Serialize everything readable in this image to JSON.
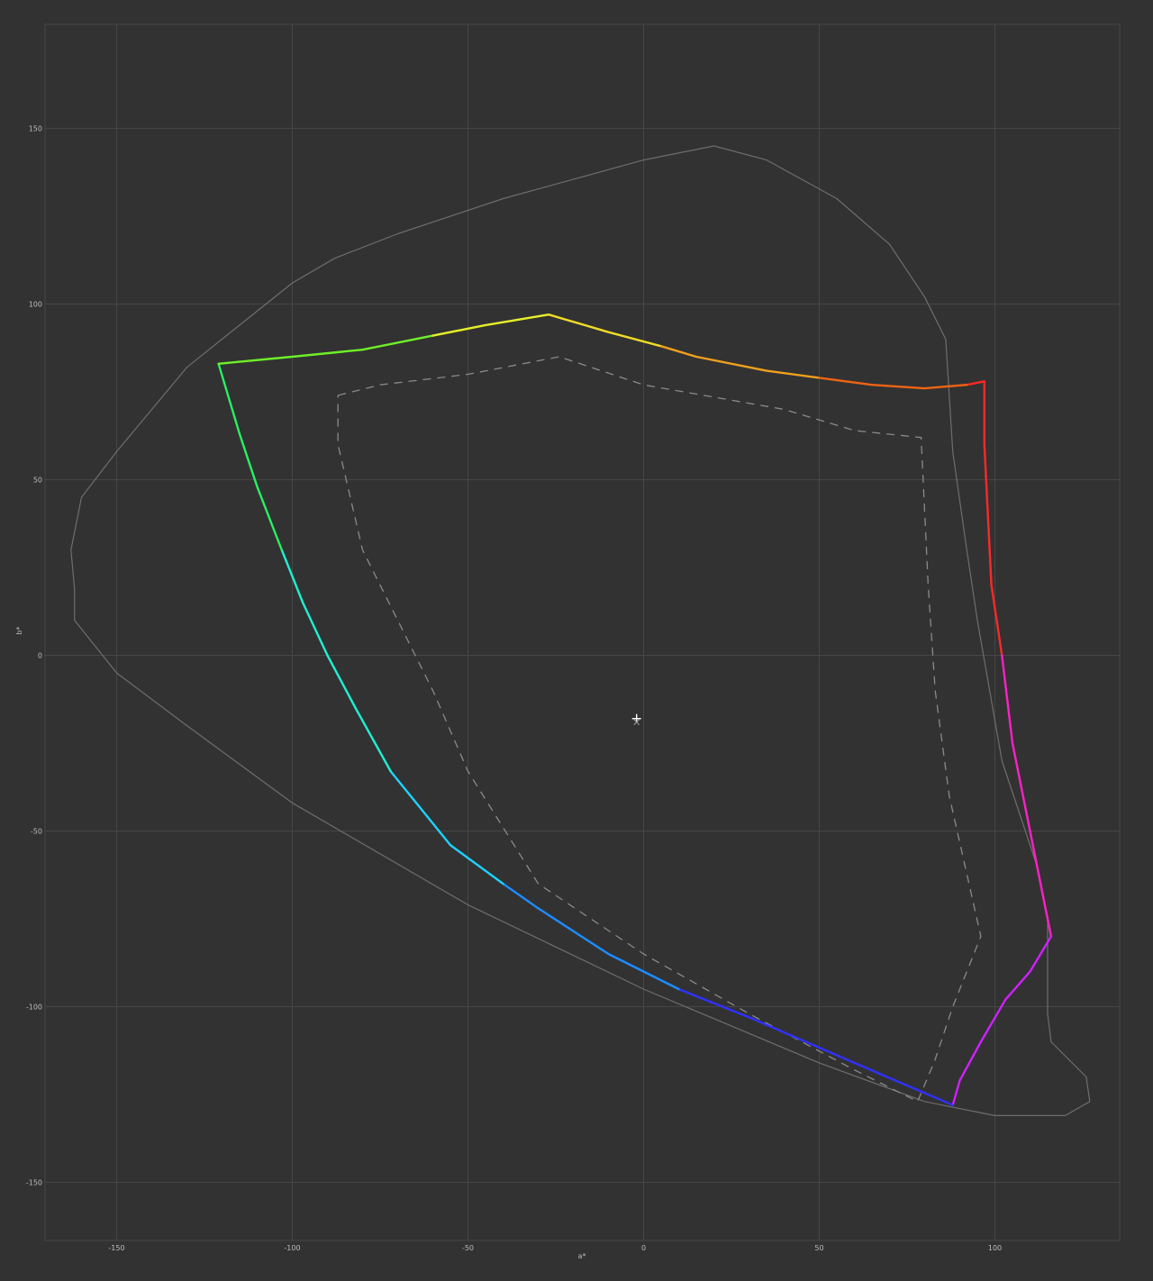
{
  "chart_data": {
    "type": "line",
    "title": "",
    "xlabel": "a*",
    "ylabel": "b*",
    "xlim": [
      -171,
      136
    ],
    "ylim": [
      -166,
      180
    ],
    "grid": true,
    "x_ticks": [
      -150,
      -100,
      -50,
      0,
      50,
      100
    ],
    "y_ticks": [
      150,
      100,
      50,
      0,
      -50,
      -100,
      -150
    ],
    "x_tick_labels": [
      "-150",
      "-100",
      "-50",
      "0",
      "50",
      "100"
    ],
    "y_tick_labels": [
      "150",
      "100",
      "50",
      "0",
      "-50",
      "-100",
      "-150"
    ],
    "white_point": [
      -2,
      -18
    ],
    "white_point_marker": [
      -2,
      -19
    ],
    "spectral_locus": [
      [
        -162,
        19
      ],
      [
        -163,
        30
      ],
      [
        -160,
        45
      ],
      [
        -150,
        58
      ],
      [
        -130,
        82
      ],
      [
        -115,
        94
      ],
      [
        -100,
        106
      ],
      [
        -88,
        113
      ],
      [
        -70,
        120
      ],
      [
        -40,
        130
      ],
      [
        0,
        141
      ],
      [
        20,
        145
      ],
      [
        35,
        141
      ],
      [
        55,
        130
      ],
      [
        70,
        117
      ],
      [
        80,
        102
      ],
      [
        86,
        90
      ],
      [
        88,
        58
      ],
      [
        92,
        30
      ],
      [
        95,
        10
      ],
      [
        102,
        -30
      ],
      [
        112,
        -60
      ],
      [
        115,
        -75
      ],
      [
        115,
        -90
      ],
      [
        115,
        -102
      ],
      [
        116,
        -110
      ],
      [
        121,
        -115
      ],
      [
        126,
        -120
      ],
      [
        127,
        -127
      ],
      [
        120,
        -131
      ],
      [
        100,
        -131
      ],
      [
        80,
        -127
      ],
      [
        50,
        -116
      ],
      [
        0,
        -95
      ],
      [
        -50,
        -71
      ],
      [
        -100,
        -42
      ],
      [
        -130,
        -20
      ],
      [
        -150,
        -5
      ],
      [
        -162,
        10
      ],
      [
        -162,
        19
      ]
    ],
    "gamut_segments": [
      {
        "color": "#ff2828",
        "points": [
          [
            92,
            77
          ],
          [
            97,
            78
          ],
          [
            97,
            60
          ],
          [
            98,
            40
          ],
          [
            99,
            20
          ],
          [
            102,
            0
          ]
        ]
      },
      {
        "color": "#ff20c8",
        "points": [
          [
            102,
            0
          ],
          [
            105,
            -25
          ],
          [
            109,
            -45
          ],
          [
            113,
            -65
          ],
          [
            116,
            -80
          ]
        ]
      },
      {
        "color": "#d020ff",
        "points": [
          [
            116,
            -80
          ],
          [
            110,
            -90
          ],
          [
            103,
            -98
          ],
          [
            96,
            -110
          ],
          [
            90,
            -121
          ],
          [
            88,
            -128
          ]
        ]
      },
      {
        "color": "#3030ff",
        "points": [
          [
            88,
            -128
          ],
          [
            60,
            -116
          ],
          [
            30,
            -103
          ],
          [
            10,
            -95
          ]
        ]
      },
      {
        "color": "#1e8cff",
        "points": [
          [
            10,
            -95
          ],
          [
            -10,
            -85
          ],
          [
            -30,
            -72
          ],
          [
            -40,
            -65
          ]
        ]
      },
      {
        "color": "#1ed2ff",
        "points": [
          [
            -40,
            -65
          ],
          [
            -55,
            -54
          ],
          [
            -72,
            -33
          ]
        ]
      },
      {
        "color": "#1ef0d2",
        "points": [
          [
            -72,
            -33
          ],
          [
            -82,
            -15
          ],
          [
            -90,
            0
          ],
          [
            -97,
            15
          ],
          [
            -103,
            30
          ]
        ]
      },
      {
        "color": "#28f064",
        "points": [
          [
            -103,
            30
          ],
          [
            -110,
            48
          ],
          [
            -115,
            63
          ],
          [
            -121,
            83
          ]
        ]
      },
      {
        "color": "#6ef028",
        "points": [
          [
            -121,
            83
          ],
          [
            -100,
            85
          ],
          [
            -80,
            87
          ],
          [
            -60,
            91
          ]
        ]
      },
      {
        "color": "#e6f028",
        "points": [
          [
            -60,
            91
          ],
          [
            -45,
            94
          ],
          [
            -27,
            97
          ]
        ]
      },
      {
        "color": "#f0dc28",
        "points": [
          [
            -27,
            97
          ],
          [
            -10,
            92
          ],
          [
            5,
            88
          ]
        ]
      },
      {
        "color": "#f0a01e",
        "points": [
          [
            5,
            88
          ],
          [
            15,
            85
          ],
          [
            35,
            81
          ],
          [
            50,
            79
          ]
        ]
      },
      {
        "color": "#f06414",
        "points": [
          [
            50,
            79
          ],
          [
            65,
            77
          ],
          [
            80,
            76
          ],
          [
            92,
            77
          ]
        ]
      }
    ],
    "reference_gamut": [
      [
        -87,
        74
      ],
      [
        -75,
        77
      ],
      [
        -50,
        80
      ],
      [
        -24,
        85
      ],
      [
        0,
        77
      ],
      [
        40,
        70
      ],
      [
        60,
        64
      ],
      [
        79,
        62
      ],
      [
        81,
        20
      ],
      [
        83,
        -10
      ],
      [
        87,
        -40
      ],
      [
        96,
        -80
      ],
      [
        88,
        -100
      ],
      [
        83,
        -115
      ],
      [
        78,
        -127
      ],
      [
        60,
        -118
      ],
      [
        30,
        -102
      ],
      [
        0,
        -85
      ],
      [
        -30,
        -65
      ],
      [
        -50,
        -33
      ],
      [
        -60,
        -10
      ],
      [
        -70,
        10
      ],
      [
        -80,
        30
      ],
      [
        -87,
        60
      ],
      [
        -87,
        74
      ]
    ]
  }
}
